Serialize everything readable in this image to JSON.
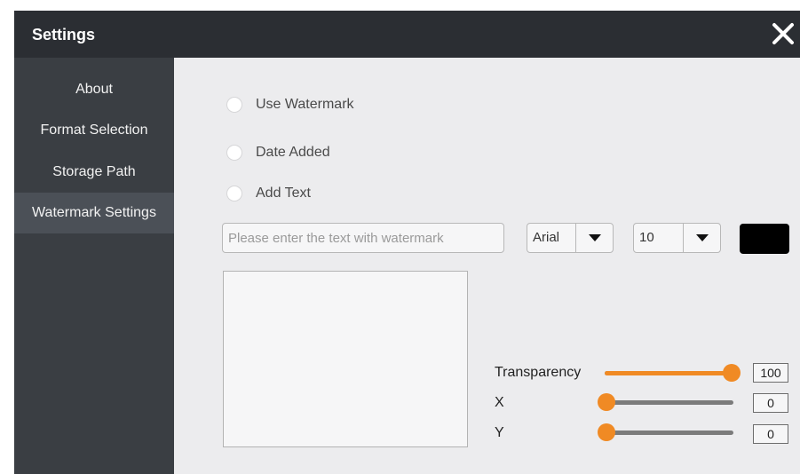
{
  "window": {
    "title": "Settings"
  },
  "sidebar": {
    "items": [
      {
        "label": "About"
      },
      {
        "label": "Format Selection"
      },
      {
        "label": "Storage Path"
      },
      {
        "label": "Watermark Settings",
        "active": true
      }
    ]
  },
  "watermark": {
    "options": [
      {
        "label": "Use Watermark"
      },
      {
        "label": "Date Added"
      },
      {
        "label": "Add Text"
      }
    ],
    "text_input": {
      "value": "",
      "placeholder": "Please enter the text with watermark"
    },
    "font_select": {
      "value": "Arial"
    },
    "size_select": {
      "value": "10"
    },
    "text_color": "#000000"
  },
  "controls": {
    "transparency": {
      "label": "Transparency",
      "value": "100",
      "level": 1.0
    },
    "x": {
      "label": "X",
      "value": "0",
      "level": 0.0
    },
    "y": {
      "label": "Y",
      "value": "0",
      "level": 0.0
    }
  },
  "colors": {
    "titlebar": "#2b2e33",
    "sidebar": "#3a3e43",
    "sidebar_active": "#4b5057",
    "content_bg": "#ececee",
    "accent": "#f08a24"
  },
  "icons": {
    "close": "close-icon",
    "dropdown": "caret-down-icon"
  }
}
